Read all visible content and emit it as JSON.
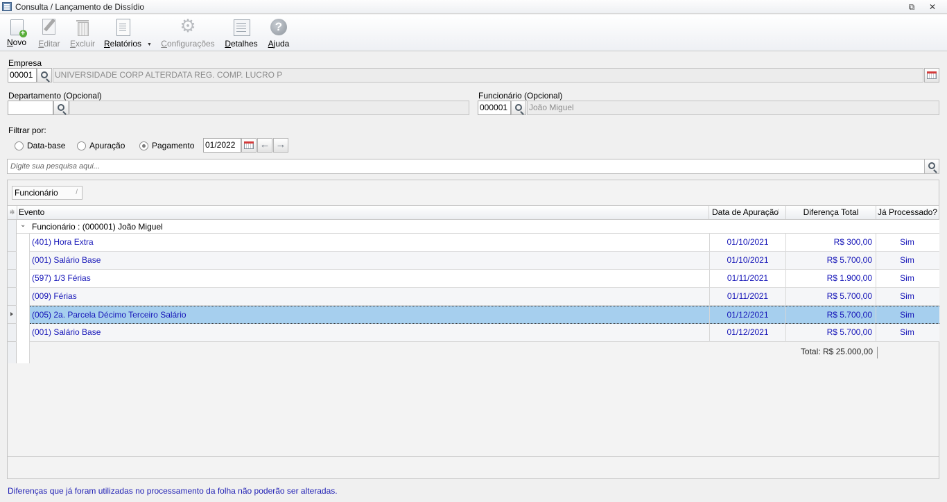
{
  "window": {
    "title": "Consulta / Lançamento de Dissídio",
    "restore_glyph": "⧉",
    "close_glyph": "✕"
  },
  "toolbar": {
    "novo": {
      "mnemonic": "N",
      "rest": "ovo"
    },
    "editar": {
      "mnemonic": "E",
      "rest": "ditar"
    },
    "excluir": {
      "mnemonic": "E",
      "rest": "xcluir"
    },
    "relatorios": {
      "mnemonic": "R",
      "rest": "elatórios"
    },
    "configuracoes": {
      "mnemonic": "C",
      "rest": "onfigurações"
    },
    "detalhes": {
      "mnemonic": "D",
      "rest": "etalhes"
    },
    "ajuda": {
      "mnemonic": "A",
      "rest": "juda"
    }
  },
  "empresa": {
    "label": "Empresa",
    "code": "00001",
    "name": "UNIVERSIDADE CORP ALTERDATA REG. COMP. LUCRO P"
  },
  "departamento": {
    "label": "Departamento (Opcional)",
    "code": "",
    "name": ""
  },
  "funcionario": {
    "label": "Funcionário (Opcional)",
    "code": "000001",
    "name": "João Miguel"
  },
  "filtro": {
    "label": "Filtrar por:",
    "options": [
      "Data-base",
      "Apuração",
      "Pagamento"
    ],
    "selected": "Pagamento",
    "period": "01/2022"
  },
  "search": {
    "placeholder": "Digite sua pesquisa aqui..."
  },
  "grouping": {
    "chip": "Funcionário",
    "sort_glyph": "/"
  },
  "grid": {
    "columns": [
      "Evento",
      "Data de Apuração",
      "Diferença Total",
      "Já Processado?"
    ],
    "indicator_glyph": "✻",
    "group_label": "Funcionário : (000001) João Miguel",
    "rows": [
      {
        "evento": "(401) Hora Extra",
        "data": "01/10/2021",
        "diferenca": "R$ 300,00",
        "processado": "Sim"
      },
      {
        "evento": "(001) Salário Base",
        "data": "01/10/2021",
        "diferenca": "R$ 5.700,00",
        "processado": "Sim"
      },
      {
        "evento": "(597) 1/3 Férias",
        "data": "01/11/2021",
        "diferenca": "R$ 1.900,00",
        "processado": "Sim"
      },
      {
        "evento": "(009) Férias",
        "data": "01/11/2021",
        "diferenca": "R$ 5.700,00",
        "processado": "Sim"
      },
      {
        "evento": "(005) 2a. Parcela Décimo Terceiro Salário",
        "data": "01/12/2021",
        "diferenca": "R$ 5.700,00",
        "processado": "Sim"
      },
      {
        "evento": "(001) Salário Base",
        "data": "01/12/2021",
        "diferenca": "R$ 5.700,00",
        "processado": "Sim"
      }
    ],
    "selected_row": 4,
    "total": "Total:  R$ 25.000,00"
  },
  "status_note": "Diferenças que já foram utilizadas no processamento da folha não poderão ser alteradas."
}
